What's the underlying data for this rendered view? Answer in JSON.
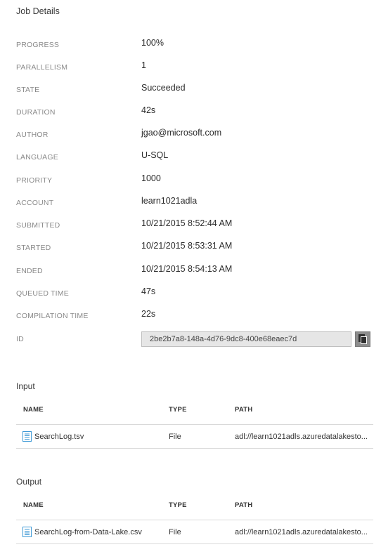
{
  "title": "Job Details",
  "properties": [
    {
      "label": "PROGRESS",
      "value": "100%"
    },
    {
      "label": "PARALLELISM",
      "value": "1"
    },
    {
      "label": "STATE",
      "value": "Succeeded"
    },
    {
      "label": "DURATION",
      "value": "42s"
    },
    {
      "label": "AUTHOR",
      "value": "jgao@microsoft.com"
    },
    {
      "label": "LANGUAGE",
      "value": "U-SQL"
    },
    {
      "label": "PRIORITY",
      "value": "1000"
    },
    {
      "label": "ACCOUNT",
      "value": "learn1021adla"
    },
    {
      "label": "SUBMITTED",
      "value": "10/21/2015 8:52:44 AM"
    },
    {
      "label": "STARTED",
      "value": "10/21/2015 8:53:31 AM"
    },
    {
      "label": "ENDED",
      "value": "10/21/2015 8:54:13 AM"
    },
    {
      "label": "QUEUED TIME",
      "value": "47s"
    },
    {
      "label": "COMPILATION TIME",
      "value": "22s"
    }
  ],
  "id": {
    "label": "ID",
    "value": "2be2b7a8-148a-4d76-9dc8-400e68eaec7d"
  },
  "input": {
    "title": "Input",
    "columns": {
      "name": "NAME",
      "type": "TYPE",
      "path": "PATH"
    },
    "rows": [
      {
        "name": "SearchLog.tsv",
        "type": "File",
        "path": "adl://learn1021adls.azuredatalakesto..."
      }
    ]
  },
  "output": {
    "title": "Output",
    "columns": {
      "name": "NAME",
      "type": "TYPE",
      "path": "PATH"
    },
    "rows": [
      {
        "name": "SearchLog-from-Data-Lake.csv",
        "type": "File",
        "path": "adl://learn1021adls.azuredatalakesto..."
      }
    ]
  },
  "colors": {
    "label": "#8a8a8a",
    "file_icon": "#3f9ad6",
    "id_box_bg": "#e6e6e6",
    "copy_button_bg": "#8d8d8d"
  },
  "icons": {
    "file": "file-icon",
    "copy": "copy-icon"
  }
}
